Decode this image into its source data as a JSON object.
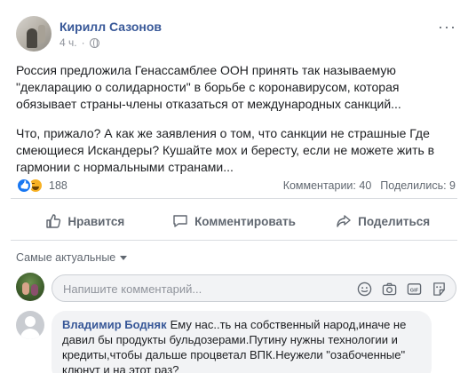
{
  "post": {
    "author": "Кирилл Сазонов",
    "time": "4 ч.",
    "more": "···",
    "paragraphs": [
      "Россия предложила Генассамблее ООН принять так называемую \"декларацию о солидарности\" в борьбе с коронавирусом, которая обязывает страны-члены отказаться от международных санкций...",
      "Что, прижало? А как же заявления о том, что санкции не страшные Где смеющиеся Искандеры? Кушайте мох и бересту, если не можете жить в гармонии с нормальными странами..."
    ]
  },
  "stats": {
    "reactions_count": "188",
    "comments": "Комментарии: 40",
    "shares": "Поделились: 9"
  },
  "actions": {
    "like": "Нравится",
    "comment": "Комментировать",
    "share": "Поделиться"
  },
  "comments_section": {
    "sort_label": "Самые актуальные",
    "composer_placeholder": "Напишите комментарий..."
  },
  "comment": {
    "author": "Владимир Бодняк",
    "text": "Ему нас..ть на собственный народ,иначе не давил бы продукты бульдозерами.Путину нужны технологии и кредиты,чтобы дальше процветал ВПК.Неужели \"озабоченные\" клюнут и на этот раз?"
  },
  "icons": [
    "globe-icon",
    "like-icon",
    "comment-icon",
    "share-icon",
    "emoji-icon",
    "camera-icon",
    "gif-icon",
    "sticker-icon"
  ],
  "colors": {
    "link": "#385898",
    "accent": "#1877f2",
    "muted": "#606770",
    "bubble": "#f2f3f5"
  }
}
